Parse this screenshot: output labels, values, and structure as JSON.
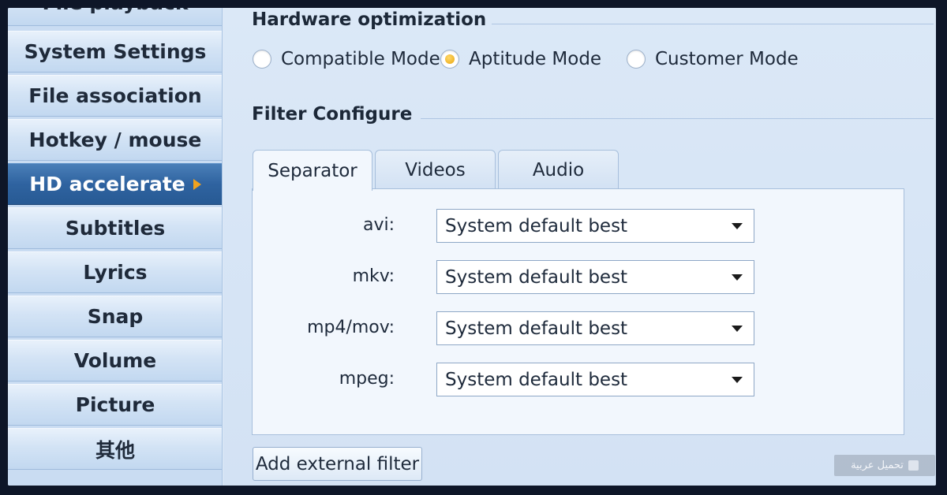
{
  "sidebar": {
    "items": [
      {
        "label": "File playback"
      },
      {
        "label": "System Settings"
      },
      {
        "label": "File association"
      },
      {
        "label": "Hotkey / mouse"
      },
      {
        "label": "HD accelerate"
      },
      {
        "label": "Subtitles"
      },
      {
        "label": "Lyrics"
      },
      {
        "label": "Snap"
      },
      {
        "label": "Volume"
      },
      {
        "label": "Picture"
      },
      {
        "label": "其他"
      }
    ],
    "active_index": 4
  },
  "hardware": {
    "title": "Hardware optimization",
    "options": [
      {
        "label": "Compatible Mode",
        "checked": false
      },
      {
        "label": "Aptitude Mode",
        "checked": true
      },
      {
        "label": "Customer Mode",
        "checked": false
      }
    ]
  },
  "filter": {
    "title": "Filter Configure",
    "tabs": [
      {
        "label": "Separator",
        "active": true
      },
      {
        "label": "Videos",
        "active": false
      },
      {
        "label": "Audio",
        "active": false
      }
    ],
    "rows": [
      {
        "label": "avi:",
        "value": "System default best"
      },
      {
        "label": "mkv:",
        "value": "System default best"
      },
      {
        "label": "mp4/mov:",
        "value": "System default best"
      },
      {
        "label": "mpeg:",
        "value": "System default best"
      }
    ],
    "add_button": "Add external filter"
  },
  "overlay": {
    "badge_text": "تحميل عربية"
  },
  "colors": {
    "active_item": "#2f63a0",
    "radio_checked": "#e9a60e"
  }
}
